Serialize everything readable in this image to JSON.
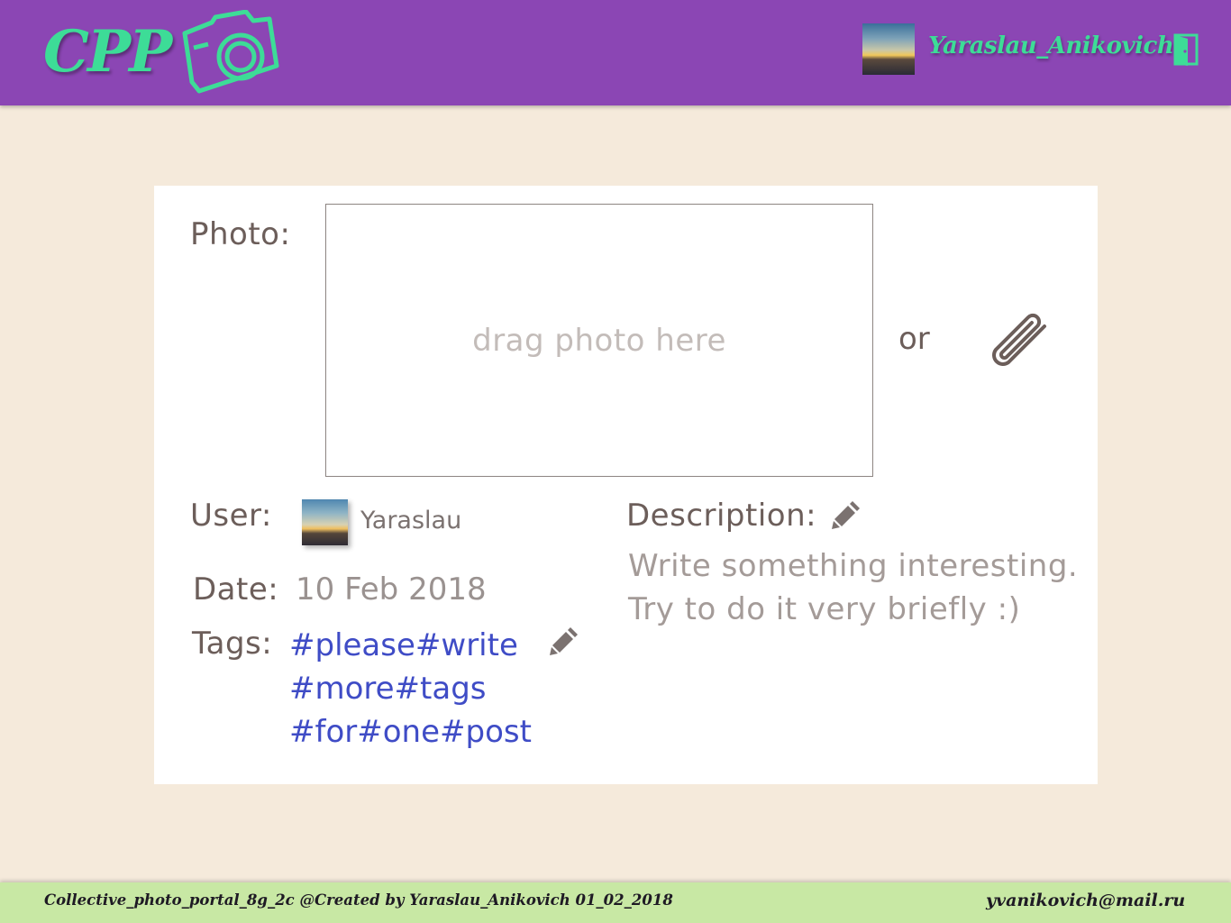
{
  "header": {
    "logo_text": "CPP",
    "username": "Yaraslau_Anikovich",
    "logo_icon": "camera-icon",
    "logout_icon": "logout-door-icon"
  },
  "form": {
    "photo_label": "Photo:",
    "dropzone_text": "drag photo here",
    "or_text": "or",
    "attach_icon": "paperclip-icon",
    "user_label": "User:",
    "user_name": "Yaraslau",
    "date_label": "Date:",
    "date_value": "10 Feb 2018",
    "tags_label": "Tags:",
    "tags_lines": [
      "#please#write",
      "#more#tags",
      "#for#one#post"
    ],
    "description_label": "Description:",
    "description_lines": [
      "Write something interesting.",
      "Try to do it very briefly :)"
    ],
    "edit_icon": "pencil-icon"
  },
  "footer": {
    "left_text": "Collective_photo_portal_8g_2c @Created by Yaraslau_Anikovich 01_02_2018",
    "email": "yvanikovich@mail.ru"
  },
  "colors": {
    "header_bg": "#8b46b4",
    "accent_green": "#3ddc97",
    "page_bg": "#f5eadb",
    "footer_bg": "#c8e8a4",
    "tag_blue": "#3f4cc6"
  }
}
